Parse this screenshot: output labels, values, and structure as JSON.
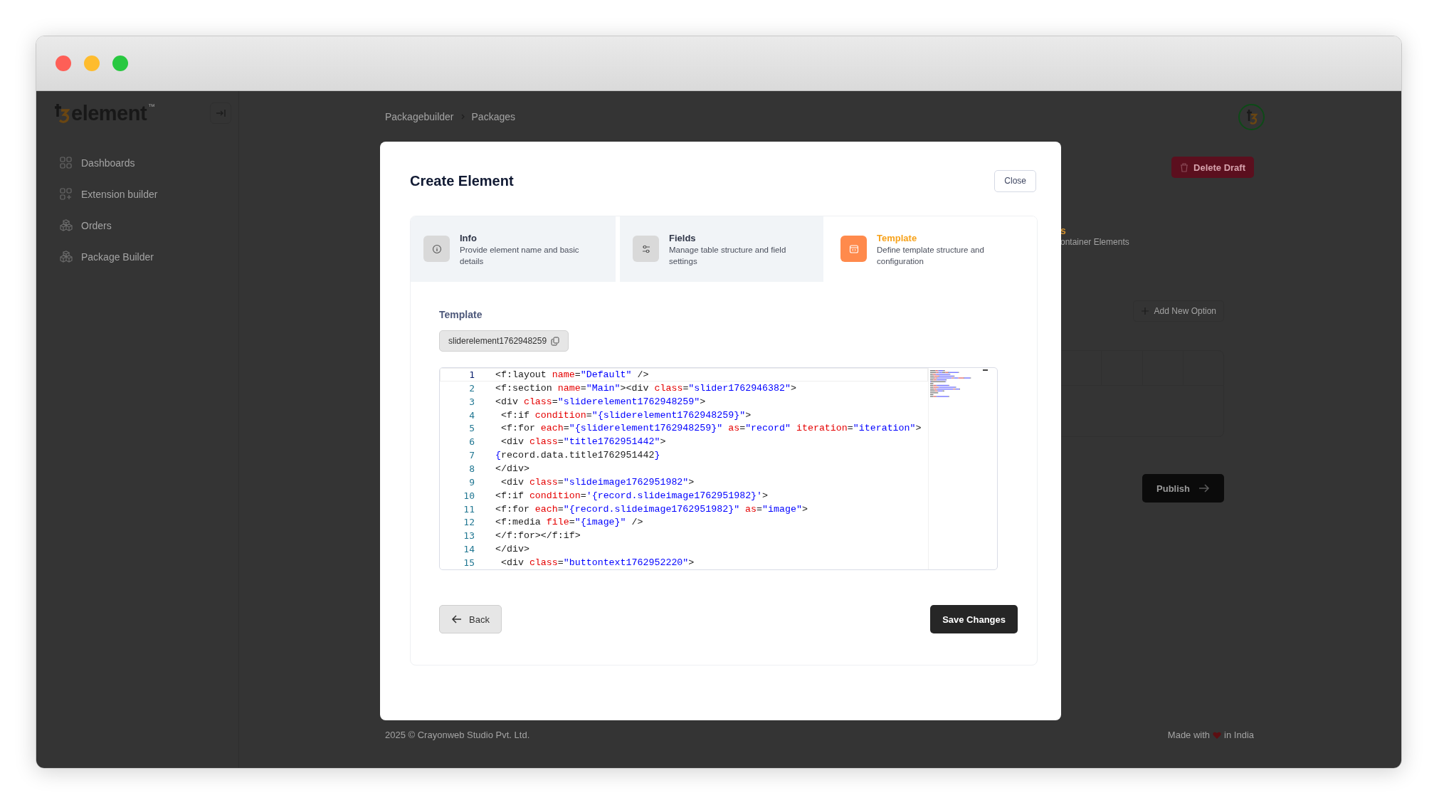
{
  "logo": {
    "text": "element",
    "mark": "™"
  },
  "sidebar": {
    "items": [
      {
        "label": "Dashboards",
        "kind": "grid"
      },
      {
        "label": "Extension builder",
        "kind": "gridplus"
      },
      {
        "label": "Orders",
        "kind": "boxes"
      },
      {
        "label": "Package Builder",
        "kind": "boxes"
      }
    ]
  },
  "breadcrumb": [
    "Packagebuilder",
    "Packages"
  ],
  "background": {
    "delete_button": "Delete Draft",
    "heading": "s",
    "description": "ontainer Elements",
    "add_button": "Add New Option",
    "publish_button": "Publish"
  },
  "modal": {
    "title": "Create Element",
    "close": "Close",
    "steps": [
      {
        "title": "Info",
        "description": "Provide element name and basic details",
        "kind": "info",
        "selected": false
      },
      {
        "title": "Fields",
        "description": "Manage table structure and field settings",
        "kind": "sliders",
        "selected": false
      },
      {
        "title": "Template",
        "description": "Define template structure and configuration",
        "kind": "code",
        "selected": true
      }
    ],
    "section_label": "Template",
    "chip": "sliderelement1762948259",
    "code": [
      {
        "number": "1",
        "current": true,
        "tokens": [
          {
            "kind": "tag",
            "text": "<f:layout "
          },
          {
            "kind": "attr",
            "text": "name"
          },
          {
            "kind": "tag",
            "text": "="
          },
          {
            "kind": "str",
            "text": "\"Default\""
          },
          {
            "kind": "tag",
            "text": " />"
          }
        ]
      },
      {
        "number": "2",
        "current": false,
        "tokens": [
          {
            "kind": "tag",
            "text": "<f:section "
          },
          {
            "kind": "attr",
            "text": "name"
          },
          {
            "kind": "tag",
            "text": "="
          },
          {
            "kind": "str",
            "text": "\"Main\""
          },
          {
            "kind": "tag",
            "text": "><div "
          },
          {
            "kind": "attr",
            "text": "class"
          },
          {
            "kind": "tag",
            "text": "="
          },
          {
            "kind": "str",
            "text": "\"slider1762946382\""
          },
          {
            "kind": "tag",
            "text": ">"
          }
        ]
      },
      {
        "number": "3",
        "current": false,
        "tokens": [
          {
            "kind": "tag",
            "text": "<div "
          },
          {
            "kind": "attr",
            "text": "class"
          },
          {
            "kind": "tag",
            "text": "="
          },
          {
            "kind": "str",
            "text": "\"sliderelement1762948259\""
          },
          {
            "kind": "tag",
            "text": ">"
          }
        ]
      },
      {
        "number": "4",
        "current": false,
        "tokens": [
          {
            "kind": "tag",
            "text": " <f:if "
          },
          {
            "kind": "attr",
            "text": "condition"
          },
          {
            "kind": "tag",
            "text": "="
          },
          {
            "kind": "str",
            "text": "\"{sliderelement1762948259}\""
          },
          {
            "kind": "tag",
            "text": ">"
          }
        ]
      },
      {
        "number": "5",
        "current": false,
        "tokens": [
          {
            "kind": "tag",
            "text": " <f:for "
          },
          {
            "kind": "attr",
            "text": "each"
          },
          {
            "kind": "tag",
            "text": "="
          },
          {
            "kind": "str",
            "text": "\"{sliderelement1762948259}\""
          },
          {
            "kind": "attr",
            "text": " as"
          },
          {
            "kind": "tag",
            "text": "="
          },
          {
            "kind": "str",
            "text": "\"record\""
          },
          {
            "kind": "attr",
            "text": " iteration"
          },
          {
            "kind": "tag",
            "text": "="
          },
          {
            "kind": "str",
            "text": "\"iteration\""
          },
          {
            "kind": "tag",
            "text": ">"
          }
        ]
      },
      {
        "number": "6",
        "current": false,
        "tokens": [
          {
            "kind": "tag",
            "text": " <div "
          },
          {
            "kind": "attr",
            "text": "class"
          },
          {
            "kind": "tag",
            "text": "="
          },
          {
            "kind": "str",
            "text": "\"title1762951442\""
          },
          {
            "kind": "tag",
            "text": ">"
          }
        ]
      },
      {
        "number": "7",
        "current": false,
        "tokens": [
          {
            "kind": "str",
            "text": "{"
          },
          {
            "kind": "tag",
            "text": "record.data.title1762951442"
          },
          {
            "kind": "str",
            "text": "}"
          }
        ]
      },
      {
        "number": "8",
        "current": false,
        "tokens": [
          {
            "kind": "tag",
            "text": "</div>"
          }
        ]
      },
      {
        "number": "9",
        "current": false,
        "tokens": [
          {
            "kind": "tag",
            "text": " <div "
          },
          {
            "kind": "attr",
            "text": "class"
          },
          {
            "kind": "tag",
            "text": "="
          },
          {
            "kind": "str",
            "text": "\"slideimage1762951982\""
          },
          {
            "kind": "tag",
            "text": ">"
          }
        ]
      },
      {
        "number": "10",
        "current": false,
        "tokens": [
          {
            "kind": "tag",
            "text": "<f:if "
          },
          {
            "kind": "attr",
            "text": "condition"
          },
          {
            "kind": "tag",
            "text": "="
          },
          {
            "kind": "str",
            "text": "'{record.slideimage1762951982}'"
          },
          {
            "kind": "tag",
            "text": ">"
          }
        ]
      },
      {
        "number": "11",
        "current": false,
        "tokens": [
          {
            "kind": "tag",
            "text": "<f:for "
          },
          {
            "kind": "attr",
            "text": "each"
          },
          {
            "kind": "tag",
            "text": "="
          },
          {
            "kind": "str",
            "text": "\"{record.slideimage1762951982}\""
          },
          {
            "kind": "attr",
            "text": " as"
          },
          {
            "kind": "tag",
            "text": "="
          },
          {
            "kind": "str",
            "text": "\"image\""
          },
          {
            "kind": "tag",
            "text": ">"
          }
        ]
      },
      {
        "number": "12",
        "current": false,
        "tokens": [
          {
            "kind": "tag",
            "text": "<f:media "
          },
          {
            "kind": "attr",
            "text": "file"
          },
          {
            "kind": "tag",
            "text": "="
          },
          {
            "kind": "str",
            "text": "\"{image}\""
          },
          {
            "kind": "tag",
            "text": " />"
          }
        ]
      },
      {
        "number": "13",
        "current": false,
        "tokens": [
          {
            "kind": "tag",
            "text": "</f:for></f:if>"
          }
        ]
      },
      {
        "number": "14",
        "current": false,
        "tokens": [
          {
            "kind": "tag",
            "text": "</div>"
          }
        ]
      },
      {
        "number": "15",
        "current": false,
        "tokens": [
          {
            "kind": "tag",
            "text": " <div "
          },
          {
            "kind": "attr",
            "text": "class"
          },
          {
            "kind": "tag",
            "text": "="
          },
          {
            "kind": "str",
            "text": "\"buttontext1762952220\""
          },
          {
            "kind": "tag",
            "text": ">"
          }
        ]
      }
    ],
    "back": "Back",
    "save": "Save Changes"
  },
  "footer": {
    "copyright": "2025 ©  Crayonweb Studio Pvt. Ltd.",
    "made_with": "Made with",
    "in_india": "in India"
  }
}
